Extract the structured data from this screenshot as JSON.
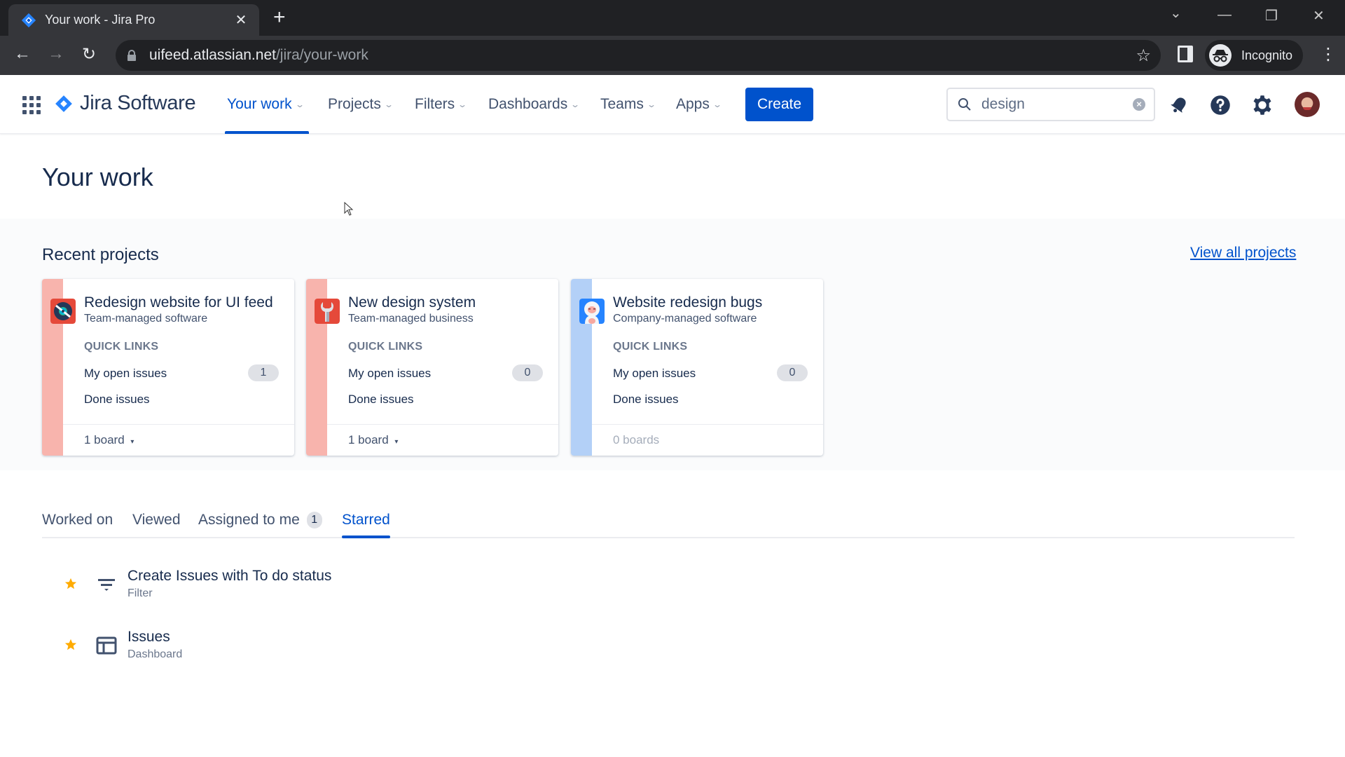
{
  "browser": {
    "tab_title": "Your work - Jira Pro",
    "tab_close": "✕",
    "new_tab": "+",
    "url_host": "uifeed.atlassian.net",
    "url_path": "/jira/your-work",
    "profile_label": "Incognito",
    "window_controls": {
      "tab_search": "⌄",
      "minimize": "—",
      "restore": "❐",
      "close": "✕"
    },
    "nav": {
      "back": "←",
      "forward": "→",
      "reload": "↻",
      "bookmark": "☆",
      "menu": "⋮"
    }
  },
  "header": {
    "product_name": "Jira Software",
    "nav_items": [
      {
        "label": "Your work",
        "active": true
      },
      {
        "label": "Projects",
        "active": false
      },
      {
        "label": "Filters",
        "active": false
      },
      {
        "label": "Dashboards",
        "active": false
      },
      {
        "label": "Teams",
        "active": false
      },
      {
        "label": "Apps",
        "active": false
      }
    ],
    "chevron": "⌄",
    "create_label": "Create",
    "search": {
      "value": "design",
      "placeholder": "Search",
      "clear": "×"
    }
  },
  "page": {
    "title": "Your work"
  },
  "recent_projects": {
    "heading": "Recent projects",
    "view_all_label": "View all projects",
    "quick_links_label": "QUICK LINKS",
    "open_issues_label": "My open issues",
    "done_issues_label": "Done issues",
    "projects": [
      {
        "name": "Redesign website for UI feed",
        "type": "Team-managed software",
        "open_issues": "1",
        "boards": "1 board",
        "has_boards": true,
        "stripe_color": "#f8b4ad",
        "icon_color": "#e5493a"
      },
      {
        "name": "New design system",
        "type": "Team-managed business",
        "open_issues": "0",
        "boards": "1 board",
        "has_boards": true,
        "stripe_color": "#f8b4ad",
        "icon_color": "#e5493a"
      },
      {
        "name": "Website redesign bugs",
        "type": "Company-managed software",
        "open_issues": "0",
        "boards": "0 boards",
        "has_boards": false,
        "stripe_color": "#b3d0f7",
        "icon_color": "#2684ff"
      }
    ]
  },
  "work_tabs": {
    "tabs": [
      {
        "label": "Worked on",
        "active": false
      },
      {
        "label": "Viewed",
        "active": false
      },
      {
        "label": "Assigned to me",
        "badge": "1",
        "active": false
      },
      {
        "label": "Starred",
        "active": true
      }
    ]
  },
  "starred": [
    {
      "title": "Create Issues with To do status",
      "subtitle": "Filter",
      "icon": "filter-icon",
      "starred": true
    },
    {
      "title": "Issues",
      "subtitle": "Dashboard",
      "icon": "dashboard-icon",
      "starred": true
    }
  ],
  "colors": {
    "brand": "#0052cc",
    "text": "#172b4d",
    "star": "#ffab00"
  }
}
